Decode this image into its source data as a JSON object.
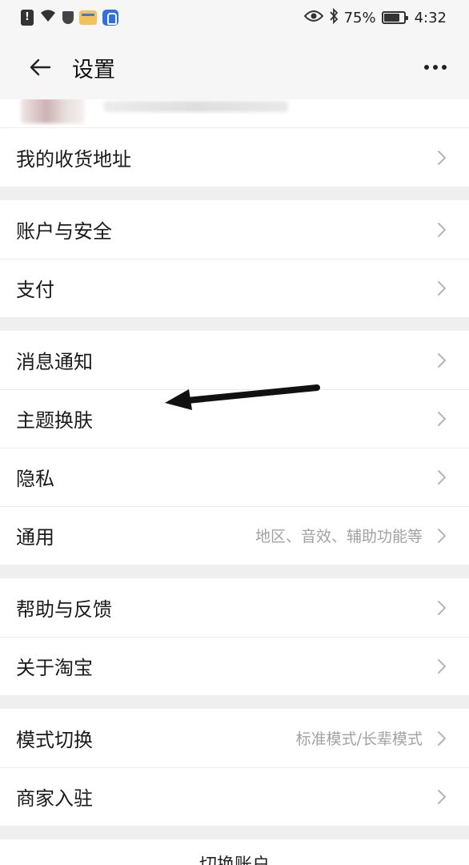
{
  "status_bar": {
    "battery_percent": "75%",
    "time": "4:32",
    "icons": [
      "alert-icon",
      "wifi-icon",
      "shield-icon",
      "app-notification-icon",
      "security-app-icon",
      "eye-icon",
      "bluetooth-icon",
      "battery-icon"
    ]
  },
  "header": {
    "title": "设置",
    "back_icon": "arrow-left-icon",
    "more_icon": "more-dots-icon"
  },
  "groups": [
    {
      "items": [
        {
          "label": "我的收货地址",
          "hint": ""
        }
      ]
    },
    {
      "items": [
        {
          "label": "账户与安全",
          "hint": ""
        },
        {
          "label": "支付",
          "hint": ""
        }
      ]
    },
    {
      "items": [
        {
          "label": "消息通知",
          "hint": ""
        },
        {
          "label": "主题换肤",
          "hint": ""
        },
        {
          "label": "隐私",
          "hint": ""
        },
        {
          "label": "通用",
          "hint": "地区、音效、辅助功能等"
        }
      ]
    },
    {
      "items": [
        {
          "label": "帮助与反馈",
          "hint": ""
        },
        {
          "label": "关于淘宝",
          "hint": ""
        }
      ]
    },
    {
      "items": [
        {
          "label": "模式切换",
          "hint": "标准模式/长辈模式"
        },
        {
          "label": "商家入驻",
          "hint": ""
        }
      ]
    }
  ],
  "bottom": {
    "label": "切换账户"
  },
  "colors": {
    "background": "#efefef",
    "row_background": "#ffffff",
    "hint_text": "#a2a2a2",
    "divider": "#ececec"
  }
}
